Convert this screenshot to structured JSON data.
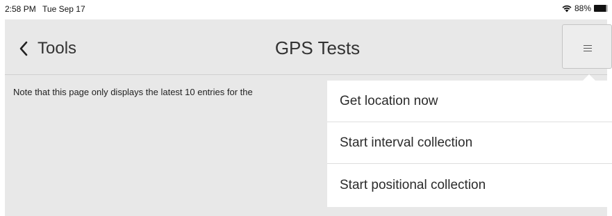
{
  "status_bar": {
    "time": "2:58 PM",
    "date": "Tue Sep 17",
    "battery": "88%",
    "battery_level": 0.88,
    "icons": [
      "wifi-icon",
      "battery-icon"
    ]
  },
  "nav": {
    "back_label": "Tools",
    "back_icon": "chevron-left-icon",
    "title": "GPS Tests",
    "menu_icon": "hamburger-menu-icon"
  },
  "content": {
    "note": "Note that this page only displays the latest 10 entries for the"
  },
  "dropdown": {
    "items": [
      {
        "label": "Get location now"
      },
      {
        "label": "Start interval collection"
      },
      {
        "label": "Start positional collection"
      }
    ]
  },
  "colors": {
    "background": "#e8e8e8",
    "menu_background": "#ffffff",
    "text": "#333333"
  }
}
